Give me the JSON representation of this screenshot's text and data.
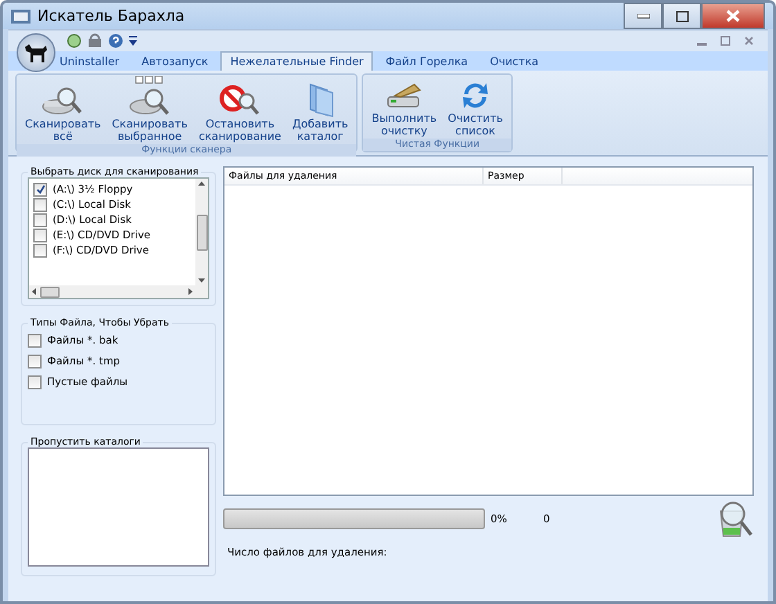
{
  "window": {
    "title": "Искатель Барахла"
  },
  "ribbon": {
    "tabs": [
      {
        "label": "Uninstaller",
        "selected": false
      },
      {
        "label": "Автозапуск",
        "selected": false
      },
      {
        "label": "Нежелательные Finder",
        "selected": true
      },
      {
        "label": "Файл Горелка",
        "selected": false
      },
      {
        "label": "Очистка",
        "selected": false
      }
    ],
    "groups": [
      {
        "label": "Функции сканера",
        "buttons": [
          {
            "label": "Сканировать\nвсё"
          },
          {
            "label": "Сканировать\nвыбранное"
          },
          {
            "label": "Остановить\nсканирование"
          },
          {
            "label": "Добавить\nкаталог"
          }
        ]
      },
      {
        "label": "Чистая Функции",
        "buttons": [
          {
            "label": "Выполнить\nочистку"
          },
          {
            "label": "Очистить\nсписок"
          }
        ]
      }
    ]
  },
  "drives": {
    "title": "Выбрать диск для сканирования",
    "items": [
      {
        "label": "(A:\\) 3½ Floppy",
        "checked": true
      },
      {
        "label": "(C:\\) Local Disk",
        "checked": false
      },
      {
        "label": "(D:\\) Local Disk",
        "checked": false
      },
      {
        "label": "(E:\\) CD/DVD Drive",
        "checked": false
      },
      {
        "label": "(F:\\) CD/DVD Drive",
        "checked": false
      }
    ]
  },
  "file_types": {
    "title": "Типы Файла, Чтобы Убрать",
    "items": [
      {
        "label": "Файлы *. bak",
        "checked": false
      },
      {
        "label": "Файлы *. tmp",
        "checked": false
      },
      {
        "label": "Пустые файлы",
        "checked": false
      }
    ]
  },
  "skip_folders": {
    "title": "Пропустить каталоги"
  },
  "file_list": {
    "columns": [
      "Файлы для удаления",
      "Размер"
    ]
  },
  "progress": {
    "level": 0,
    "percent": "0%",
    "count": "0"
  },
  "status": {
    "label": "Число файлов для удаления:"
  }
}
